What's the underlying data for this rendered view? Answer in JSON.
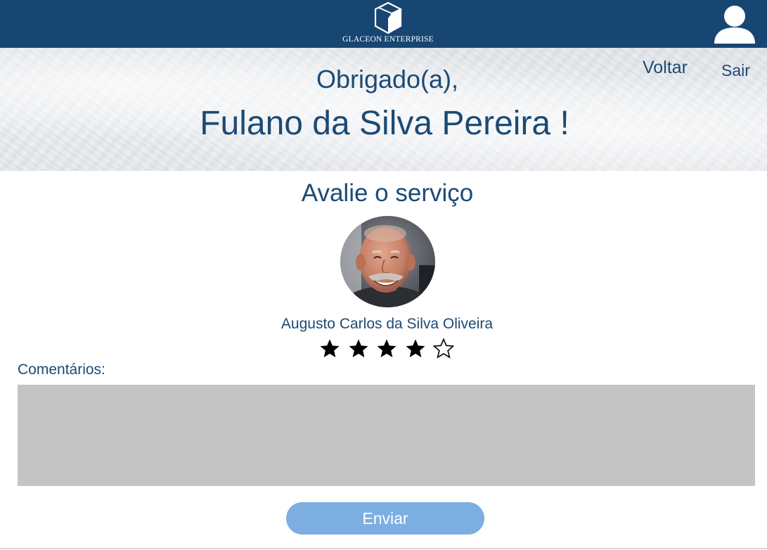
{
  "header": {
    "logo_text": "GLACEON ENTERPRISE",
    "logo_icon": "cube-icon",
    "user_icon": "user-icon",
    "background_color": "#174672"
  },
  "hero": {
    "thanks_text": "Obrigado(a),",
    "customer_name": "Fulano da Silva Pereira !",
    "nav": {
      "back_label": "Voltar",
      "logout_label": "Sair"
    }
  },
  "rating": {
    "title": "Avalie o serviço",
    "provider_name": "Augusto Carlos da Silva Oliveira",
    "stars_filled": 4,
    "stars_total": 5
  },
  "comments": {
    "label": "Comentários:",
    "value": ""
  },
  "submit": {
    "label": "Enviar"
  },
  "colors": {
    "primary_text": "#1c4a75",
    "button": "#7caee2",
    "textarea": "#c4c4c4"
  }
}
